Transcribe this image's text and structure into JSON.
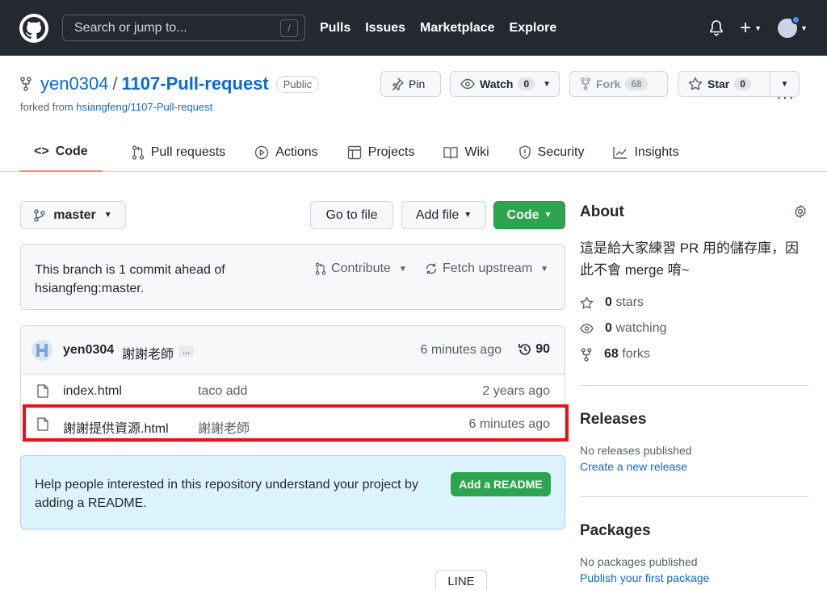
{
  "header": {
    "search_placeholder": "Search or jump to...",
    "search_shortcut": "/",
    "nav": [
      "Pulls",
      "Issues",
      "Marketplace",
      "Explore"
    ],
    "plus_label": "+"
  },
  "repo": {
    "owner": "yen0304",
    "separator": "/",
    "name": "1107-Pull-request",
    "visibility": "Public",
    "forked_prefix": "forked from",
    "forked_source": "hsiangfeng/1107-Pull-request",
    "pin_label": "Pin",
    "watch_label": "Watch",
    "watch_count": "0",
    "fork_label": "Fork",
    "fork_count": "68",
    "star_label": "Star",
    "star_count": "0"
  },
  "tabs": [
    {
      "label": "Code",
      "icon": "code-icon"
    },
    {
      "label": "Pull requests",
      "icon": "pull-request-icon"
    },
    {
      "label": "Actions",
      "icon": "play-icon"
    },
    {
      "label": "Projects",
      "icon": "table-icon"
    },
    {
      "label": "Wiki",
      "icon": "book-icon"
    },
    {
      "label": "Security",
      "icon": "shield-icon"
    },
    {
      "label": "Insights",
      "icon": "graph-icon"
    }
  ],
  "tabs_more": "···",
  "toolbar": {
    "branch": "master",
    "go_to_file": "Go to file",
    "add_file": "Add file",
    "code": "Code"
  },
  "ahead": {
    "text": "This branch is 1 commit ahead of hsiangfeng:master.",
    "contribute": "Contribute",
    "fetch": "Fetch upstream"
  },
  "commit": {
    "user": "yen0304",
    "message": "謝謝老師",
    "ellipsis": "...",
    "time": "6 minutes ago",
    "count": "90"
  },
  "files": [
    {
      "name": "index.html",
      "message": "taco add",
      "time": "2 years ago"
    },
    {
      "name": "謝謝提供資源.html",
      "message": "謝謝老師",
      "time": "6 minutes ago"
    }
  ],
  "readme": {
    "text": "Help people interested in this repository understand your project by adding a README.",
    "button": "Add a README"
  },
  "line_button": "LINE",
  "about": {
    "title": "About",
    "description": "這是給大家練習 PR 用的儲存庫，因此不會 merge 唷~",
    "stars_count": "0",
    "stars_label": "stars",
    "watching_count": "0",
    "watching_label": "watching",
    "forks_count": "68",
    "forks_label": "forks"
  },
  "releases": {
    "title": "Releases",
    "none": "No releases published",
    "link": "Create a new release"
  },
  "packages": {
    "title": "Packages",
    "none": "No packages published",
    "link": "Publish your first package"
  },
  "colors": {
    "header_bg": "#24292f",
    "link": "#0969da",
    "green": "#2da44e",
    "highlight": "#e3141b",
    "tab_underline": "#fd8c73"
  }
}
